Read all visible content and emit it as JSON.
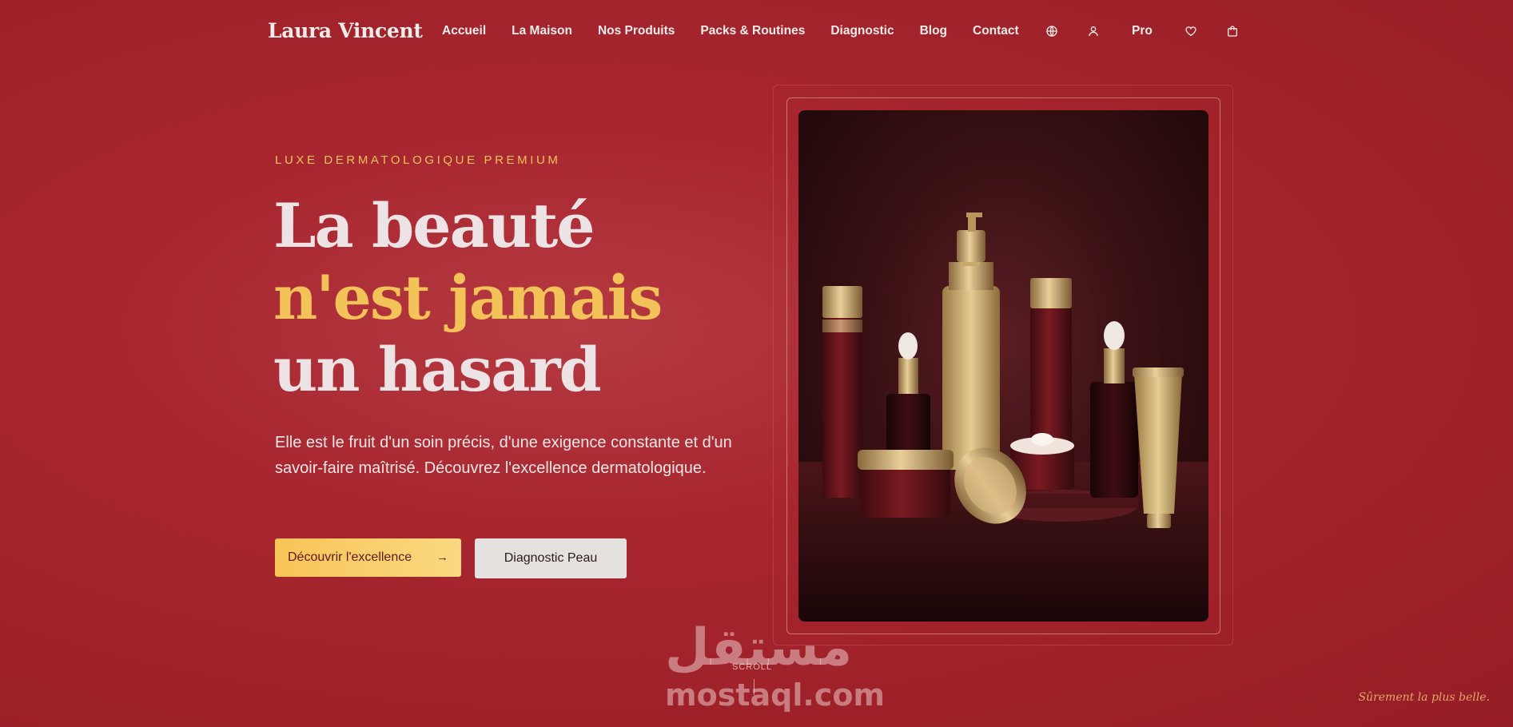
{
  "brand": {
    "name": "Laura Vincent"
  },
  "nav": {
    "items": [
      {
        "label": "Accueil"
      },
      {
        "label": "La Maison"
      },
      {
        "label": "Nos Produits"
      },
      {
        "label": "Packs & Routines"
      },
      {
        "label": "Diagnostic"
      },
      {
        "label": "Blog"
      },
      {
        "label": "Contact"
      }
    ]
  },
  "header_actions": {
    "language_icon": "globe-icon",
    "account_icon": "user-icon",
    "pro_label": "Pro",
    "wishlist_icon": "heart-icon",
    "cart_icon": "shopping-bag-icon"
  },
  "hero": {
    "eyebrow": "LUXE DERMATOLOGIQUE PREMIUM",
    "headline_line1": "La beauté",
    "headline_line2": "n'est jamais",
    "headline_line3": "un hasard",
    "description": "Elle est le fruit d'un soin précis, d'une exigence constante et d'un savoir-faire maîtrisé. Découvrez l'excellence dermatologique.",
    "primary_cta": "Découvrir l'excellence",
    "primary_cta_icon": "arrow-right-icon",
    "secondary_cta": "Diagnostic Peau"
  },
  "scroll": {
    "label": "SCROLL"
  },
  "watermark": {
    "arabic": "مستقل",
    "latin": "mostaql.com"
  },
  "tagline": "Sûrement la plus belle.",
  "colors": {
    "background": "#a8262f",
    "accent_gold": "#f3c258",
    "cta_primary": "#f7c457",
    "cta_secondary": "#e4e1df"
  }
}
